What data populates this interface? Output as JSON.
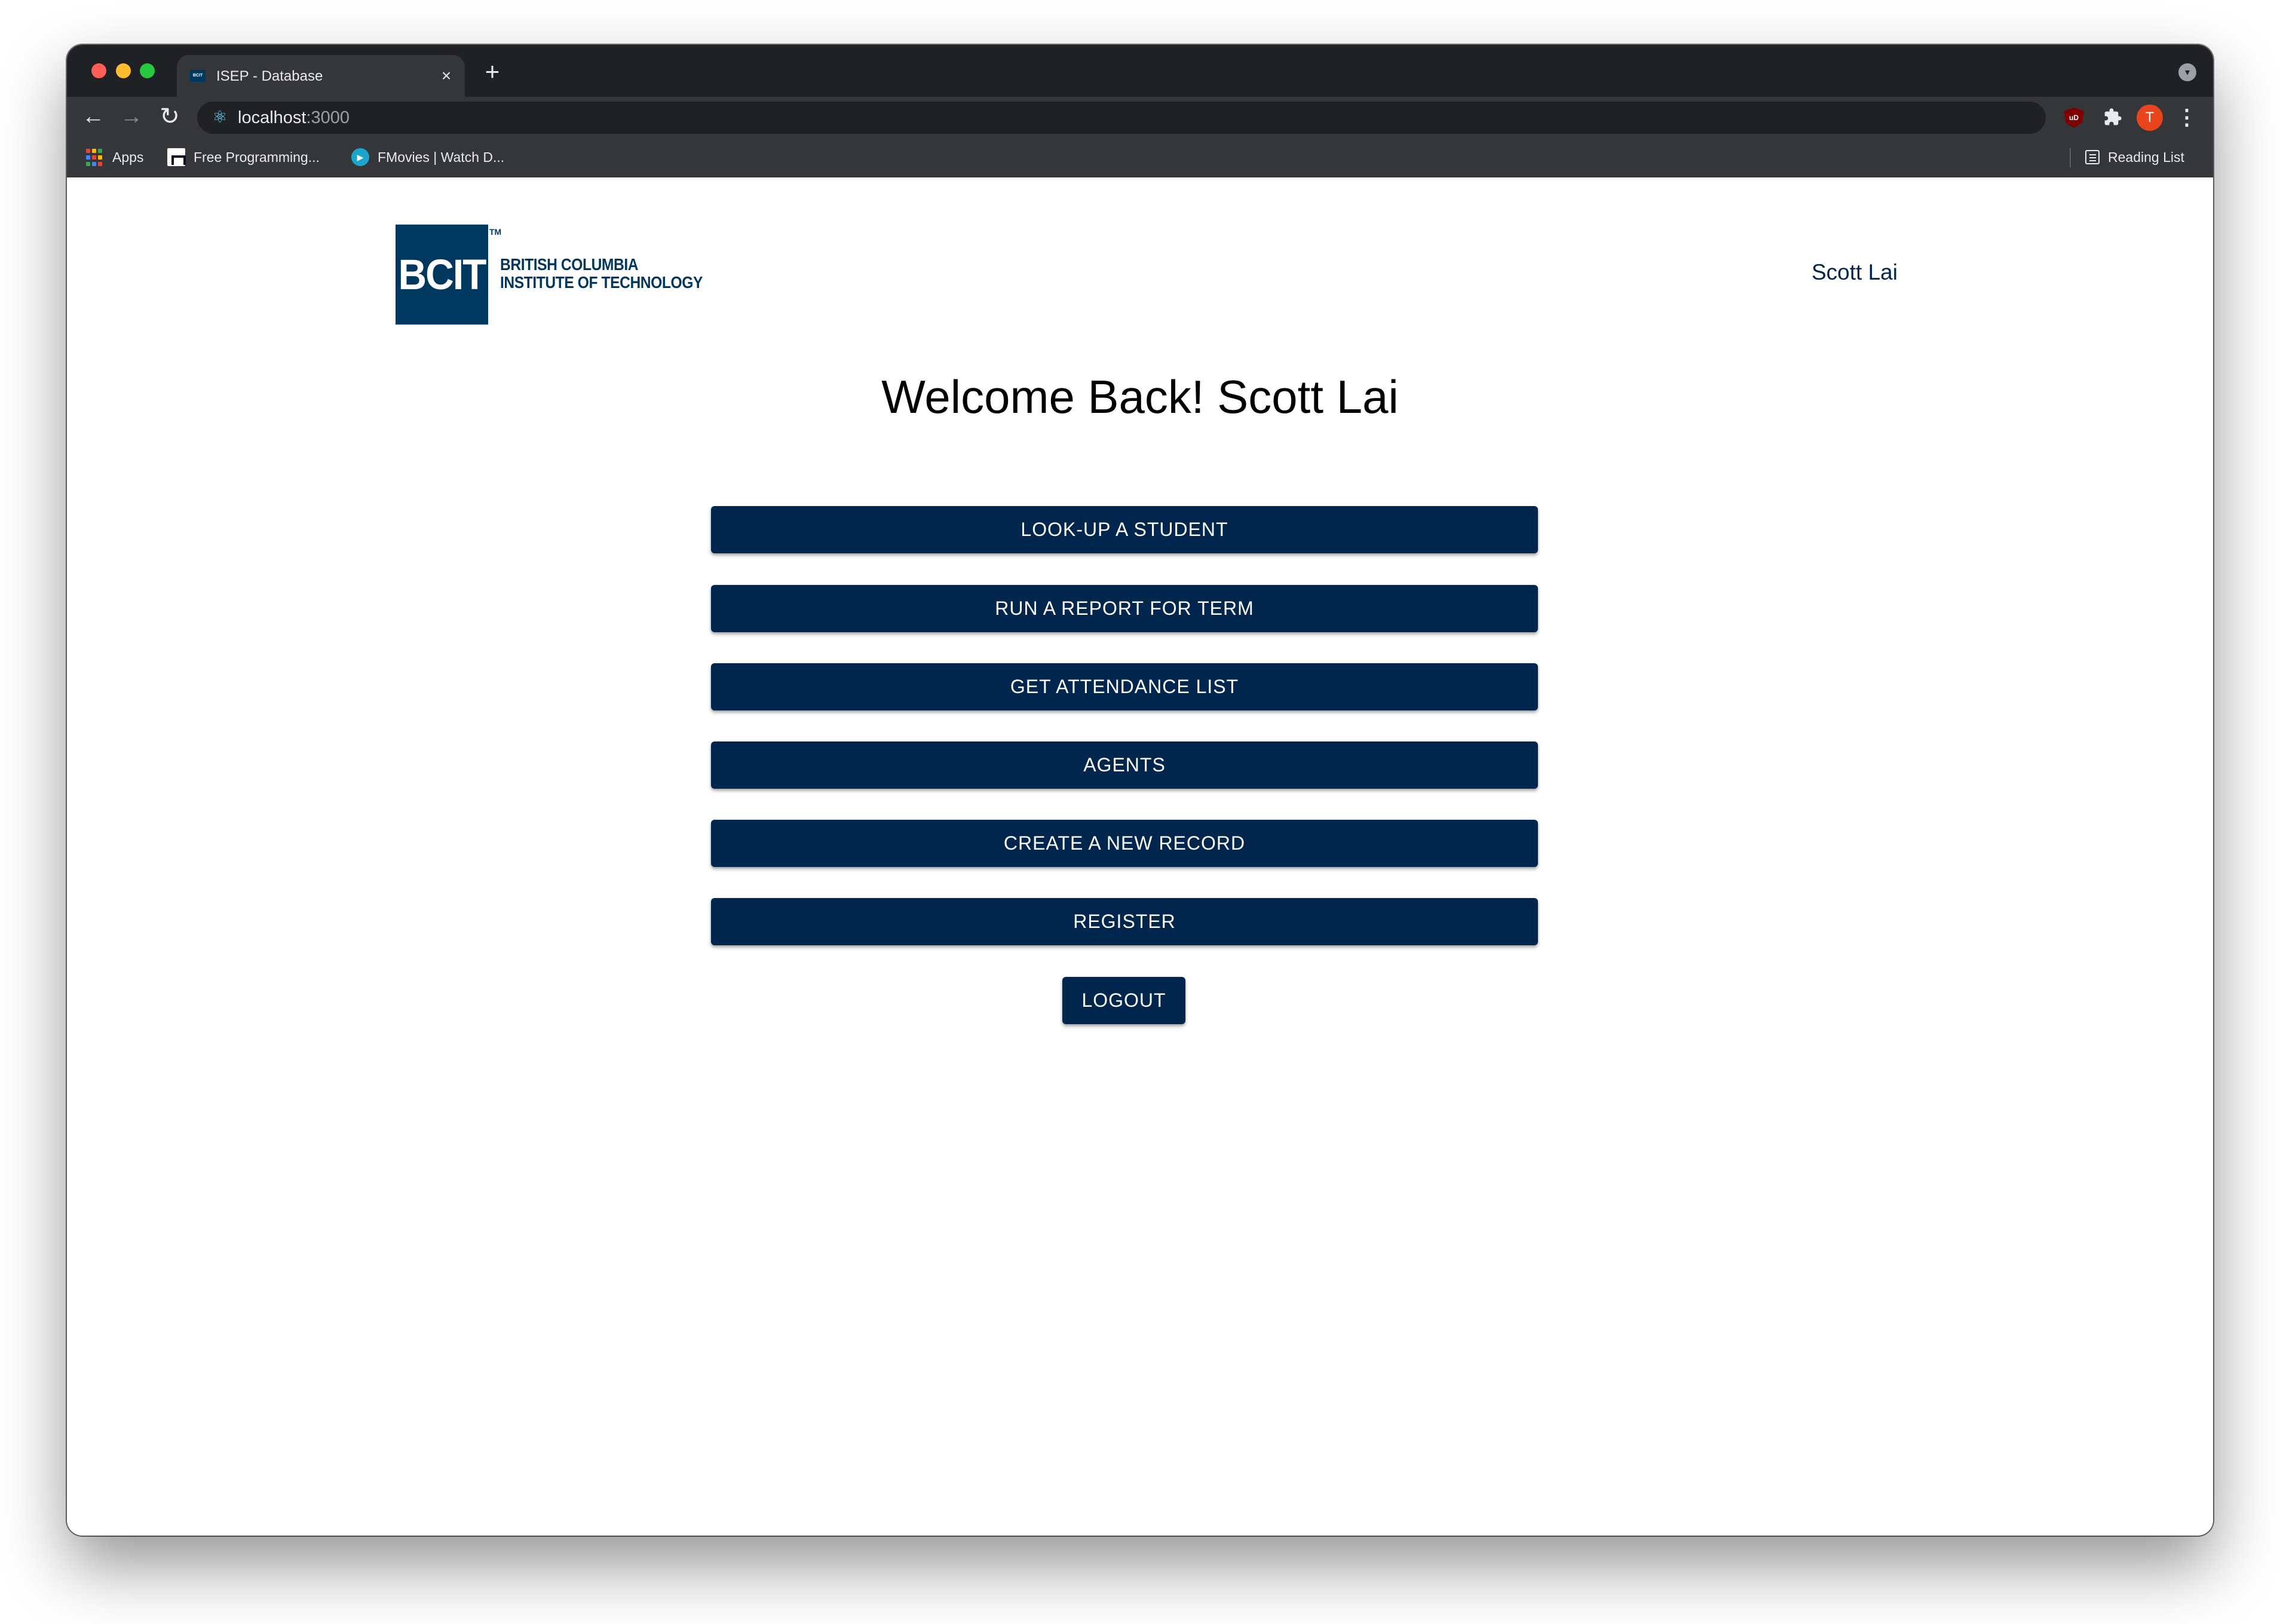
{
  "browser": {
    "tab": {
      "favicon_text": "BCIT",
      "title": "ISEP - Database",
      "close_icon": "×"
    },
    "new_tab_icon": "+",
    "toolbar": {
      "back_icon": "←",
      "forward_icon": "→",
      "reload_icon": "↻",
      "url_host": "localhost",
      "url_port": ":3000",
      "extension_badge": "uD",
      "profile_initial": "T",
      "menu_icon": "⋮"
    },
    "bookmarks": [
      {
        "label": "Apps"
      },
      {
        "label": "Free Programming..."
      },
      {
        "label": "FMovies | Watch D..."
      }
    ],
    "reading_list_label": "Reading List"
  },
  "header": {
    "logo": {
      "box_text": "BCIT",
      "tm": "TM",
      "line1": "BRITISH COLUMBIA",
      "line2": "INSTITUTE OF TECHNOLOGY"
    },
    "user_name": "Scott Lai"
  },
  "main": {
    "welcome": "Welcome Back! Scott Lai",
    "actions": [
      {
        "label": "LOOK-UP A STUDENT"
      },
      {
        "label": "RUN A REPORT FOR TERM"
      },
      {
        "label": "GET ATTENDANCE LIST"
      },
      {
        "label": "AGENTS"
      },
      {
        "label": "CREATE A NEW RECORD"
      },
      {
        "label": "REGISTER"
      }
    ],
    "logout_label": "LOGOUT"
  },
  "colors": {
    "brand_navy": "#00375f",
    "button_navy": "#00264d",
    "chrome_dark": "#202124",
    "chrome_toolbar": "#35363a",
    "profile_orange": "#e8451d"
  }
}
